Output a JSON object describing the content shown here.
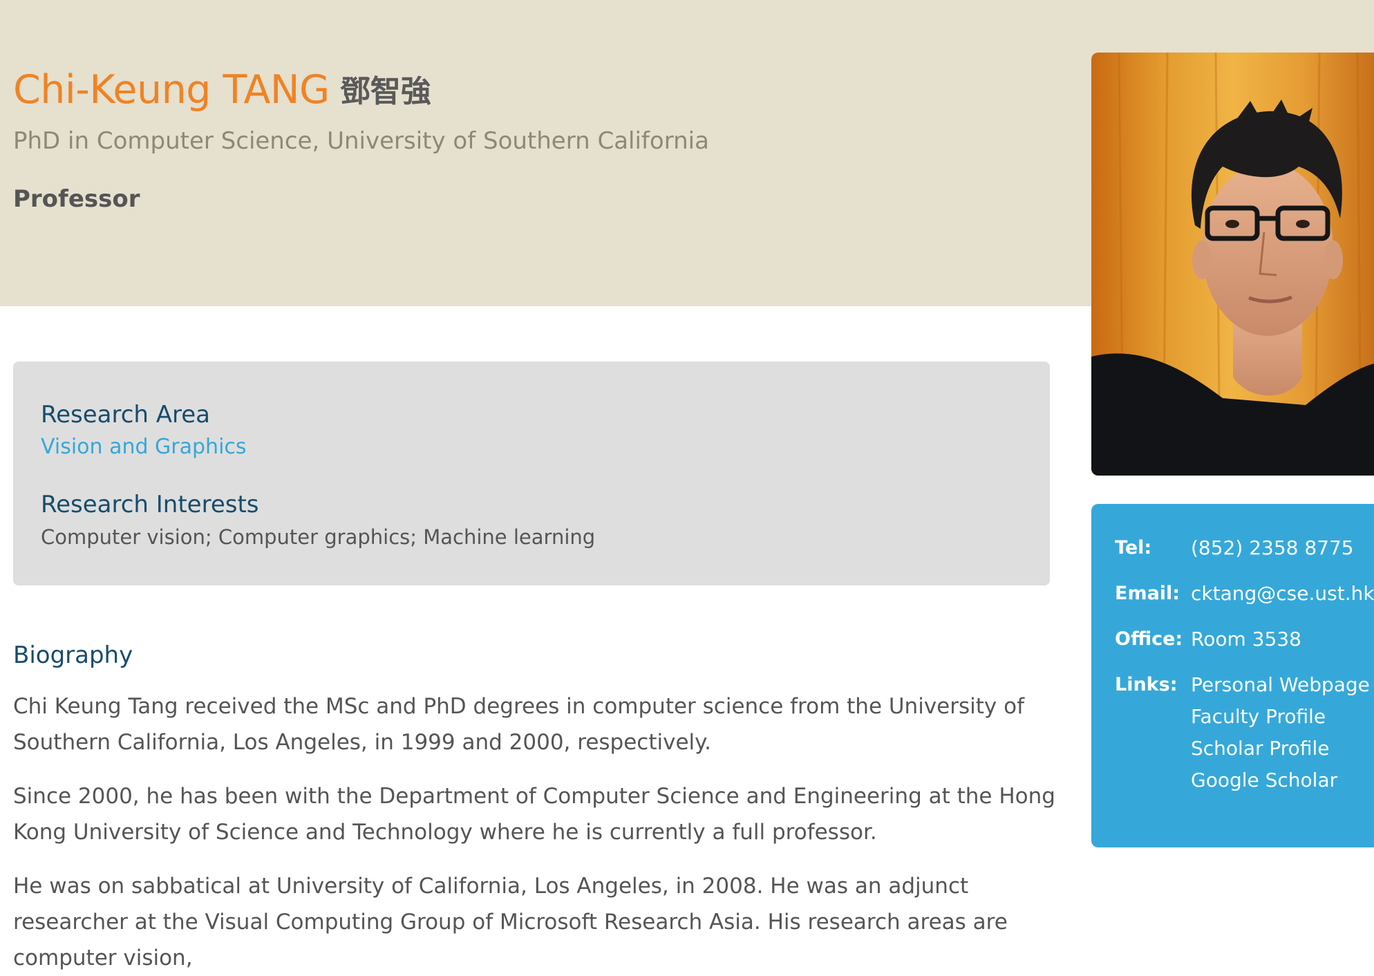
{
  "profile": {
    "name": "Chi-Keung TANG",
    "name_chinese": "鄧智強",
    "degree": "PhD in Computer Science, University of Southern California",
    "position": "Professor"
  },
  "research": {
    "area_heading": "Research Area",
    "area_link": "Vision and Graphics",
    "interests_heading": "Research Interests",
    "interests_text": "Computer vision; Computer graphics; Machine learning"
  },
  "biography": {
    "heading": "Biography",
    "paragraphs": [
      "Chi Keung Tang received the MSc and PhD degrees in computer science from the University of Southern California, Los Angeles, in 1999 and 2000, respectively.",
      "Since 2000, he has been with the Department of Computer Science and Engineering at the Hong Kong University of Science and Technology where he is currently a full professor.",
      "He was on sabbatical at University of California, Los Angeles, in 2008. He was an adjunct researcher at the Visual Computing Group of Microsoft Research Asia. His research areas are computer vision,"
    ]
  },
  "contact": {
    "tel_label": "Tel:",
    "tel_value": "(852) 2358 8775",
    "email_label": "Email:",
    "email_value": "cktang@cse.ust.hk",
    "office_label": "Office:",
    "office_value": "Room 3538",
    "links_label": "Links:",
    "links": [
      "Personal Webpage",
      "Faculty Profile",
      "Scholar Profile",
      "Google Scholar"
    ]
  },
  "colors": {
    "hero_background": "#e6e0cf",
    "name_accent": "#ef8325",
    "heading_navy": "#174c6b",
    "link_blue": "#35a8d9",
    "contact_panel": "#35a8d9",
    "research_box": "#dedede"
  }
}
